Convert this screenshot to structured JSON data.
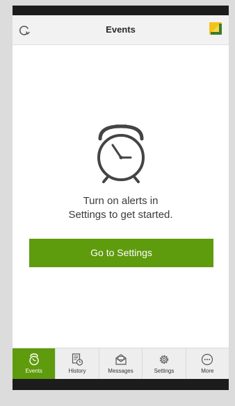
{
  "header": {
    "title": "Events",
    "refresh_icon": "refresh-icon",
    "logo_icon": "brand-logo-icon"
  },
  "empty_state": {
    "icon": "alarm-clock-icon",
    "line1": "Turn on alerts in",
    "line2": "Settings to get started.",
    "button_label": "Go to Settings"
  },
  "tabs": [
    {
      "label": "Events",
      "icon": "alarm-clock-icon",
      "active": true
    },
    {
      "label": "History",
      "icon": "history-icon",
      "active": false
    },
    {
      "label": "Messages",
      "icon": "messages-icon",
      "active": false
    },
    {
      "label": "Settings",
      "icon": "gear-icon",
      "active": false
    },
    {
      "label": "More",
      "icon": "more-icon",
      "active": false
    }
  ],
  "colors": {
    "accent": "#5e9b0d",
    "header_bg": "#f2f2f2",
    "tab_bg": "#eeeeee",
    "system_bar": "#1c1c1c"
  }
}
